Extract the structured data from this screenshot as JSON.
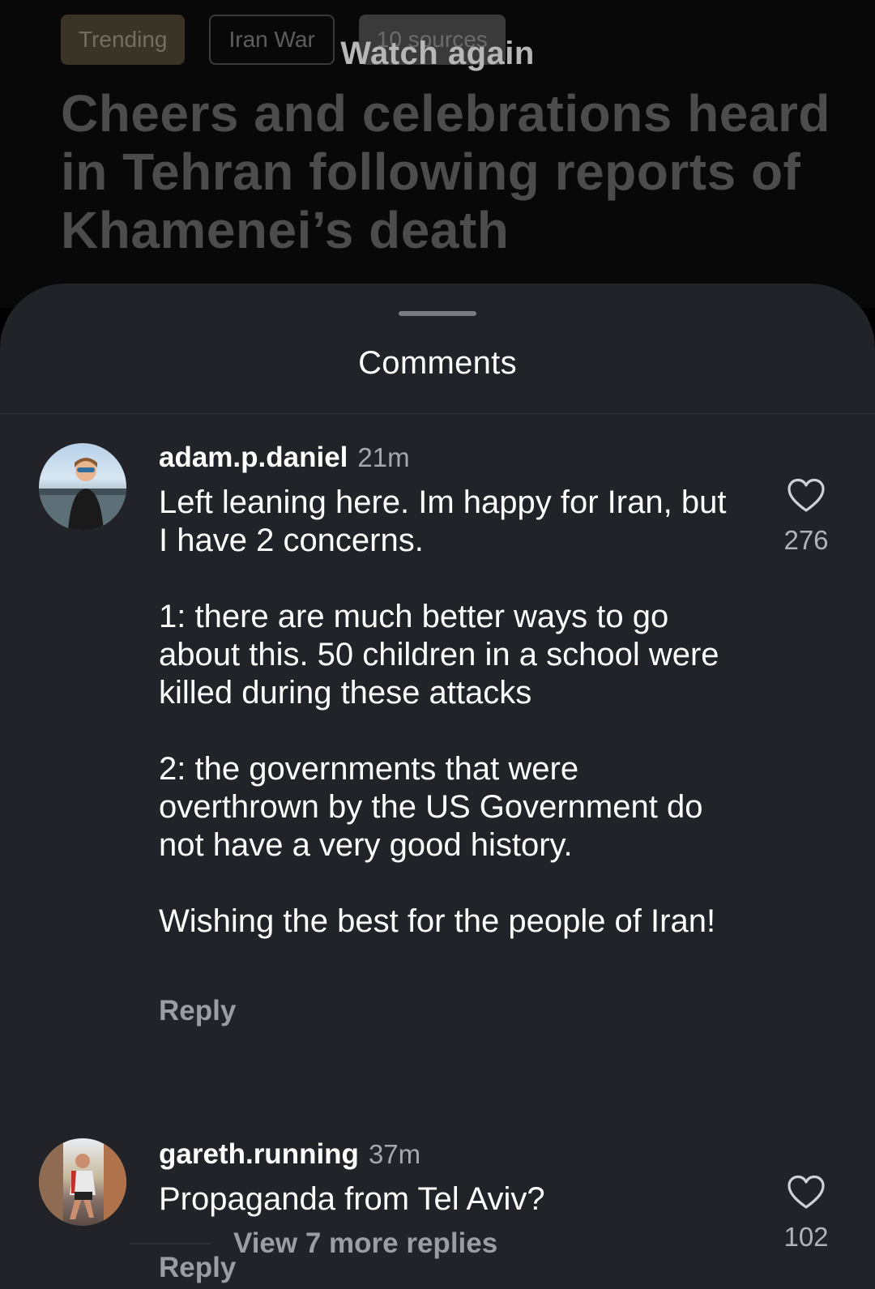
{
  "article": {
    "tags": [
      "Trending",
      "Iran War",
      "10 sources"
    ],
    "overlay_label": "Watch again",
    "headline": "Cheers and celebrations heard in Tehran following reports of Khamenei’s death"
  },
  "sheet": {
    "title": "Comments"
  },
  "comments": [
    {
      "username": "adam.p.daniel",
      "time": "21m",
      "text": "Left leaning here. Im happy for Iran, but I have 2 concerns.\n\n1: there are much better ways to go about this. 50 children in a school were killed during these attacks\n\n2: the governments that were overthrown by the US Government do not have a very good history.\n\nWishing the best for the people of Iran!",
      "reply_label": "Reply",
      "likes": "276",
      "more_replies_label": "View 7 more replies",
      "avatar_icon": "avatar-photo"
    },
    {
      "username": "gareth.running",
      "time": "37m",
      "text": "Propaganda from Tel Aviv?",
      "reply_label": "Reply",
      "likes": "102",
      "avatar_icon": "avatar-photo"
    }
  ],
  "colors": {
    "sheet_background": "#222328",
    "muted_text": "#9c9da2"
  }
}
